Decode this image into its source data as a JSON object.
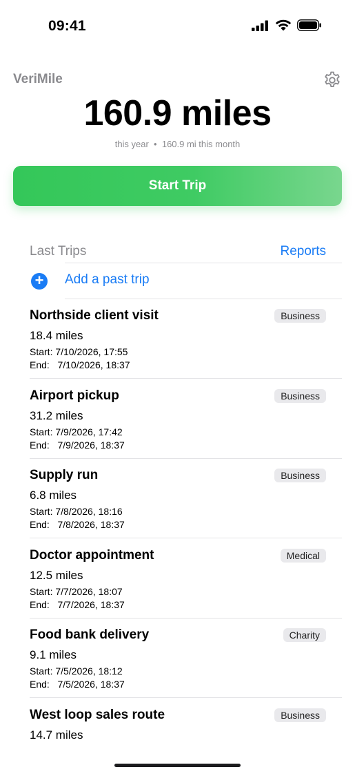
{
  "status": {
    "time": "09:41"
  },
  "app": {
    "name": "VeriMile",
    "settings_icon": "gear-icon"
  },
  "summary": {
    "total": "160.9 miles",
    "subtitle": "this year  •  160.9 mi this month"
  },
  "start_button": {
    "label": "Start Trip"
  },
  "trips_section": {
    "title": "Last Trips",
    "reports_label": "Reports",
    "add_label": "Add a past trip"
  },
  "trips": [
    {
      "name": "Northside client visit",
      "category": "Business",
      "miles": "18.4 miles",
      "start": "Start: 7/10/2026, 17:55",
      "end": "End:   7/10/2026, 18:37"
    },
    {
      "name": "Airport pickup",
      "category": "Business",
      "miles": "31.2 miles",
      "start": "Start: 7/9/2026, 17:42",
      "end": "End:   7/9/2026, 18:37"
    },
    {
      "name": "Supply run",
      "category": "Business",
      "miles": "6.8 miles",
      "start": "Start: 7/8/2026, 18:16",
      "end": "End:   7/8/2026, 18:37"
    },
    {
      "name": "Doctor appointment",
      "category": "Medical",
      "miles": "12.5 miles",
      "start": "Start: 7/7/2026, 18:07",
      "end": "End:   7/7/2026, 18:37"
    },
    {
      "name": "Food bank delivery",
      "category": "Charity",
      "miles": "9.1 miles",
      "start": "Start: 7/5/2026, 18:12",
      "end": "End:   7/5/2026, 18:37"
    },
    {
      "name": "West loop sales route",
      "category": "Business",
      "miles": "14.7 miles",
      "start": "",
      "end": ""
    }
  ],
  "colors": {
    "accent": "#1a7cf5",
    "start_green": "#34c759",
    "secondary_text": "#8a8a8e"
  }
}
